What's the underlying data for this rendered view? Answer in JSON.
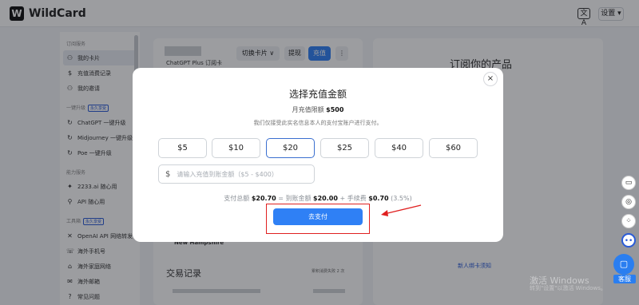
{
  "app": {
    "logo_mark": "W",
    "title": "WildCard",
    "lang_icon": "文A",
    "settings": "设置 ▾"
  },
  "sidebar": {
    "group1": "订阅服务",
    "items1": [
      {
        "icon": "⚇",
        "label": "我的卡片"
      },
      {
        "icon": "$",
        "label": "充值消费记录"
      },
      {
        "icon": "⚇",
        "label": "我的邀请"
      }
    ],
    "group2": "一键升级",
    "group2_badge": "永久享受",
    "items2": [
      {
        "icon": "↻",
        "label": "ChatGPT 一键升级"
      },
      {
        "icon": "↻",
        "label": "Midjourney 一键升级"
      },
      {
        "icon": "↻",
        "label": "Poe 一键升级"
      }
    ],
    "group3": "能力服务",
    "items3": [
      {
        "icon": "✦",
        "label": "2233.ai 随心用"
      },
      {
        "icon": "⚲",
        "label": "API 随心用"
      }
    ],
    "group4": "工具箱",
    "group4_badge": "永久享受",
    "items4": [
      {
        "icon": "✕",
        "label": "OpenAI API 网络转发"
      },
      {
        "icon": "☏",
        "label": "海外手机号"
      },
      {
        "icon": "⌂",
        "label": "海外家庭网络"
      },
      {
        "icon": "✉",
        "label": "海外邮箱"
      },
      {
        "icon": "?",
        "label": "常见问题"
      }
    ]
  },
  "background": {
    "card_label": "ChatGPT Plus 订阅卡",
    "switch_card": "切换卡片 ∨",
    "withdraw": "提现",
    "recharge": "充值",
    "more": "⋮",
    "state": "New Hampshire",
    "txn_title": "交易记录",
    "txn_note": "累积消费失败 2 次",
    "subscribe_title": "订阅你的产品",
    "new_card_link": "新人绑卡须知"
  },
  "modal": {
    "title": "选择充值金额",
    "close": "×",
    "limit_label": "月充值限额",
    "limit_value": "$500",
    "note": "我们仅接受此实名信息本人的支付宝账户进行支付。",
    "amounts": [
      "$5",
      "$10",
      "$20",
      "$25",
      "$40",
      "$60"
    ],
    "selected_amount": "$20",
    "dollar": "$",
    "custom_placeholder": "请输入充值到账金额（$5 - $400）",
    "summary": {
      "total_label": "支付总额",
      "total_value": "$20.70",
      "eq": "=",
      "arrive_label": "到账金额",
      "arrive_value": "$20.00",
      "plus": "+",
      "fee_label": "手续费",
      "fee_value": "$0.70",
      "fee_pct": "(3.5%)"
    },
    "pay_button": "去支付"
  },
  "float": {
    "support_label": "客服"
  },
  "watermark": {
    "line1": "激活 Windows",
    "line2": "转到\"设置\"以激活 Windows。"
  },
  "colors": {
    "primary": "#2f80f5",
    "annotation": "#e02020",
    "selected_border": "#3a6fd0"
  }
}
